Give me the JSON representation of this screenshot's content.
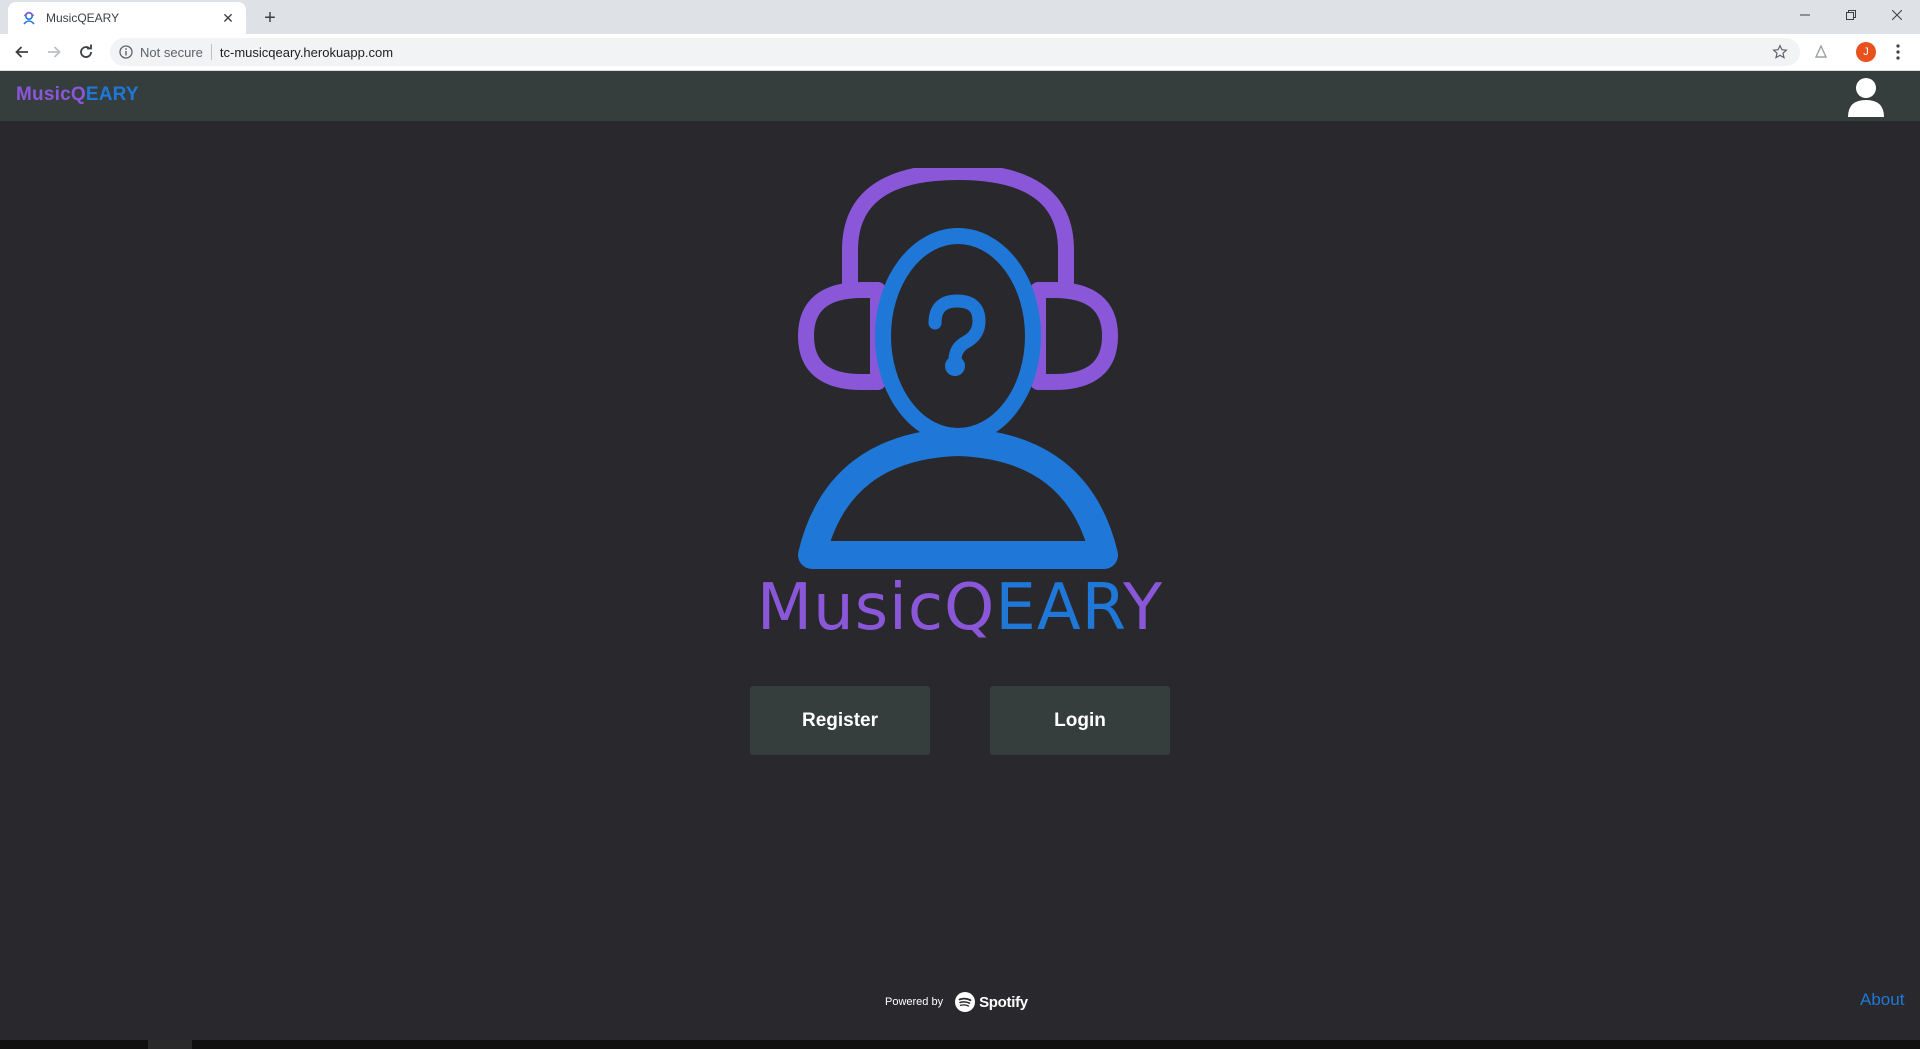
{
  "browser": {
    "tab_title": "MusicQEARY",
    "security_label": "Not secure",
    "url": "tc-musicqeary.herokuapp.com",
    "profile_initial": "J"
  },
  "app": {
    "brand_part1": "MusicQ",
    "brand_part2": "EARY",
    "hero_part1": "MusicQ",
    "hero_part2": "EAR",
    "hero_part3": "Y",
    "register_label": "Register",
    "login_label": "Login",
    "powered_by": "Powered by",
    "spotify_label": "Spotify",
    "about_label": "About"
  },
  "colors": {
    "purple": "#8b57d9",
    "blue": "#1f78d8",
    "background": "#28282d",
    "navbar": "#363d3d"
  }
}
